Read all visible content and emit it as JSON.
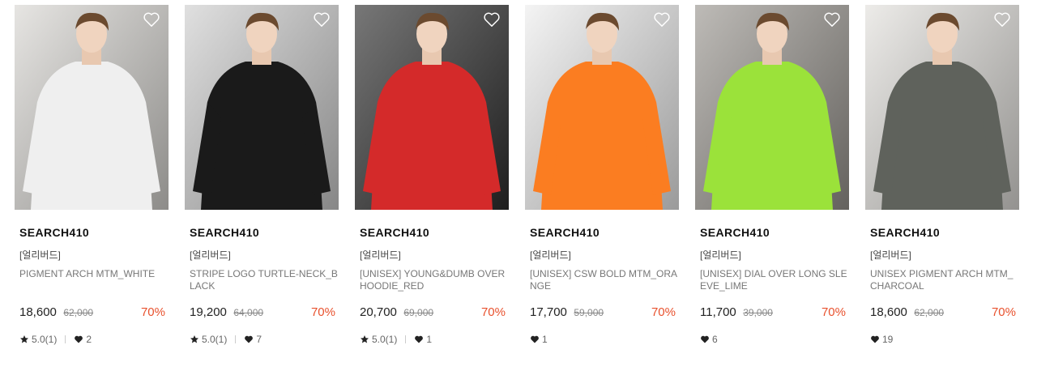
{
  "colors": {
    "discount": "#e8512d",
    "text": "#222222",
    "muted": "#777777"
  },
  "products": [
    {
      "brand": "SEARCH410",
      "tag": "[얼리버드]",
      "name": "PIGMENT ARCH MTM_WHITE",
      "price": "18,600",
      "original_price": "62,000",
      "discount": "70%",
      "rating": "5.0(1)",
      "likes": "2",
      "show_rating": true,
      "garment_color": "#efefef",
      "bg_color": "#d9d7d3",
      "photo_desc": "white-sweatshirt-model"
    },
    {
      "brand": "SEARCH410",
      "tag": "[얼리버드]",
      "name": "STRIPE LOGO TURTLE-NECK_BLACK",
      "price": "19,200",
      "original_price": "64,000",
      "discount": "70%",
      "rating": "5.0(1)",
      "likes": "7",
      "show_rating": true,
      "garment_color": "#1a1a1a",
      "bg_color": "#cfcfcf",
      "photo_desc": "striped-turtleneck-model"
    },
    {
      "brand": "SEARCH410",
      "tag": "[얼리버드]",
      "name": "[UNISEX] YOUNG&DUMB OVER HOODIE_RED",
      "price": "20,700",
      "original_price": "69,000",
      "discount": "70%",
      "rating": "5.0(1)",
      "likes": "1",
      "show_rating": true,
      "garment_color": "#d42a2a",
      "bg_color": "#2e2e2e",
      "photo_desc": "red-hoodie-model"
    },
    {
      "brand": "SEARCH410",
      "tag": "[얼리버드]",
      "name": "[UNISEX] CSW BOLD MTM_ORANGE",
      "price": "17,700",
      "original_price": "59,000",
      "discount": "70%",
      "rating": "",
      "likes": "1",
      "show_rating": false,
      "garment_color": "#fb7d21",
      "bg_color": "#eeeeee",
      "photo_desc": "orange-sweatshirt-model"
    },
    {
      "brand": "SEARCH410",
      "tag": "[얼리버드]",
      "name": "[UNISEX] DIAL OVER LONG SLEEVE_LIME",
      "price": "11,700",
      "original_price": "39,000",
      "discount": "70%",
      "rating": "",
      "likes": "6",
      "show_rating": false,
      "garment_color": "#9be23a",
      "bg_color": "#9a9690",
      "photo_desc": "lime-longsleeve-model"
    },
    {
      "brand": "SEARCH410",
      "tag": "[얼리버드]",
      "name": "UNISEX PIGMENT ARCH MTM_CHARCOAL",
      "price": "18,600",
      "original_price": "62,000",
      "discount": "70%",
      "rating": "",
      "likes": "19",
      "show_rating": false,
      "garment_color": "#5f625c",
      "bg_color": "#e3e1dd",
      "photo_desc": "charcoal-sweatshirt-model"
    }
  ],
  "icons": {
    "wishlist": "heart-outline-icon",
    "rating": "star-icon",
    "likes": "heart-filled-icon"
  }
}
